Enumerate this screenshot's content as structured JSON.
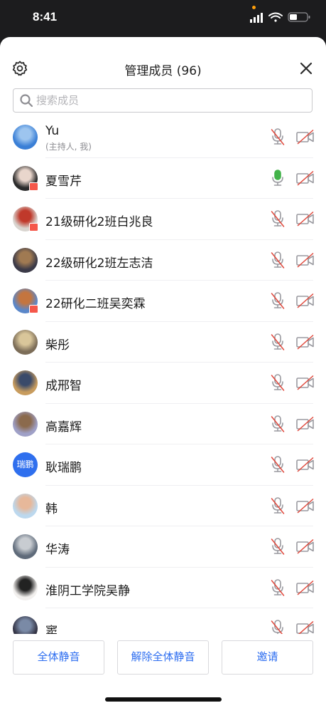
{
  "status": {
    "time": "8:41"
  },
  "header": {
    "title": "管理成员 (96)"
  },
  "search": {
    "placeholder": "搜索成员",
    "value": ""
  },
  "members": [
    {
      "name": "Yu",
      "subtitle": "(主持人, 我)",
      "avatar": "photo",
      "colors": [
        "#3a7fd6",
        "#9dc5ef"
      ],
      "badge": false,
      "mic": "muted",
      "camera": "off"
    },
    {
      "name": "夏雪芹",
      "avatar": "photo",
      "colors": [
        "#2b2b2b",
        "#e9d6cc"
      ],
      "badge": true,
      "mic": "on",
      "camera": "off"
    },
    {
      "name": "21级研化2班白兆良",
      "avatar": "photo",
      "colors": [
        "#d9d5d0",
        "#c0392b"
      ],
      "badge": true,
      "mic": "muted",
      "camera": "off"
    },
    {
      "name": "22级研化2班左志洁",
      "avatar": "photo",
      "colors": [
        "#3b3a48",
        "#a07a52"
      ],
      "badge": false,
      "mic": "muted",
      "camera": "off"
    },
    {
      "name": "22研化二班吴奕霖",
      "avatar": "photo",
      "colors": [
        "#5a87c9",
        "#c4753f"
      ],
      "badge": true,
      "mic": "muted",
      "camera": "off"
    },
    {
      "name": "柴彤",
      "avatar": "photo",
      "colors": [
        "#7c6d58",
        "#d9c69a"
      ],
      "badge": false,
      "mic": "muted",
      "camera": "off"
    },
    {
      "name": "成邢智",
      "avatar": "photo",
      "colors": [
        "#c89c5e",
        "#3a4a6a"
      ],
      "badge": false,
      "mic": "muted",
      "camera": "off"
    },
    {
      "name": "高嘉辉",
      "avatar": "photo",
      "colors": [
        "#9fa0c7",
        "#8b6a4c"
      ],
      "badge": false,
      "mic": "muted",
      "camera": "off"
    },
    {
      "name": "耿瑞鹏",
      "avatar": "text",
      "initials": "瑞鹏",
      "colors": [
        "#2f6fee",
        "#2f6fee"
      ],
      "badge": false,
      "mic": "muted",
      "camera": "off"
    },
    {
      "name": "韩",
      "avatar": "photo",
      "colors": [
        "#bcd8ee",
        "#e7b89a"
      ],
      "badge": false,
      "mic": "muted",
      "camera": "off"
    },
    {
      "name": "华涛",
      "avatar": "photo",
      "colors": [
        "#5f6b7a",
        "#c8ccd1"
      ],
      "badge": false,
      "mic": "muted",
      "camera": "off"
    },
    {
      "name": "淮阴工学院吴静",
      "avatar": "photo",
      "colors": [
        "#f2f0ee",
        "#222222"
      ],
      "badge": false,
      "mic": "muted",
      "camera": "off"
    },
    {
      "name": "窦",
      "avatar": "photo",
      "colors": [
        "#333344",
        "#7a8aa6"
      ],
      "badge": false,
      "mic": "muted",
      "camera": "off"
    }
  ],
  "actions": {
    "mute_all": "全体静音",
    "unmute_all": "解除全体静音",
    "invite": "邀请"
  },
  "icons": {
    "settings": "gear-icon",
    "close": "close-icon",
    "search": "search-icon",
    "mic_muted": "mic-muted-icon",
    "mic_on": "mic-on-icon",
    "camera_off": "camera-off-icon"
  },
  "theme": {
    "accent": "#2c6df0",
    "mic_on": "#43b34a",
    "muted_slash": "#e0483c",
    "icon_grey": "#9a9aa0"
  }
}
